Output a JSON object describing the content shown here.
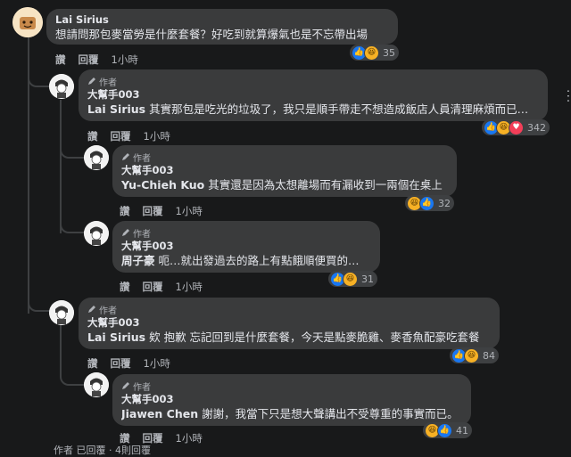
{
  "top_comment": {
    "name": "Lai Sirius",
    "text": "想請問那包麥當勞是什麼套餐？好吃到就算爆氣也是不忘帶出場",
    "like_label": "讚",
    "reply_label": "回覆",
    "time": "1小時",
    "reaction_count": "35",
    "reactions": [
      "like-icon",
      "haha-icon"
    ]
  },
  "replies": [
    {
      "badge": "作者",
      "name": "大幫手003",
      "mention": "Lai Sirius",
      "text": " 其實那包是吃光的垃圾了，我只是順手帶走不想造成飯店人員清理麻煩而已…",
      "like_label": "讚",
      "reply_label": "回覆",
      "time": "1小時",
      "reaction_count": "342",
      "reactions": [
        "like-icon",
        "haha-icon",
        "love-icon"
      ]
    },
    {
      "badge": "作者",
      "name": "大幫手003",
      "mention": "Yu-Chieh Kuo",
      "text": " 其實還是因為太想離場而有漏收到一兩個在桌上",
      "like_label": "讚",
      "reply_label": "回覆",
      "time": "1小時",
      "reaction_count": "32",
      "reactions": [
        "haha-icon",
        "like-icon"
      ]
    },
    {
      "badge": "作者",
      "name": "大幫手003",
      "mention": "周子豪",
      "text": " 呃…就出發過去的路上有點餓順便買的…",
      "like_label": "讚",
      "reply_label": "回覆",
      "time": "1小時",
      "reaction_count": "31",
      "reactions": [
        "like-icon",
        "haha-icon"
      ]
    },
    {
      "badge": "作者",
      "name": "大幫手003",
      "mention": "Lai Sirius",
      "text": " 欸 抱歉 忘記回到是什麼套餐，今天是點麥脆雞、麥香魚配豪吃套餐",
      "like_label": "讚",
      "reply_label": "回覆",
      "time": "1小時",
      "reaction_count": "84",
      "reactions": [
        "like-icon",
        "haha-icon"
      ]
    },
    {
      "badge": "作者",
      "name": "大幫手003",
      "mention": "Jiawen Chen",
      "text": " 謝謝，我當下只是想大聲講出不受尊重的事實而已。",
      "like_label": "讚",
      "reply_label": "回覆",
      "time": "1小時",
      "reaction_count": "41",
      "reactions": [
        "haha-icon",
        "like-icon"
      ]
    }
  ],
  "footer_text": "作者 已回覆 · 4則回覆"
}
